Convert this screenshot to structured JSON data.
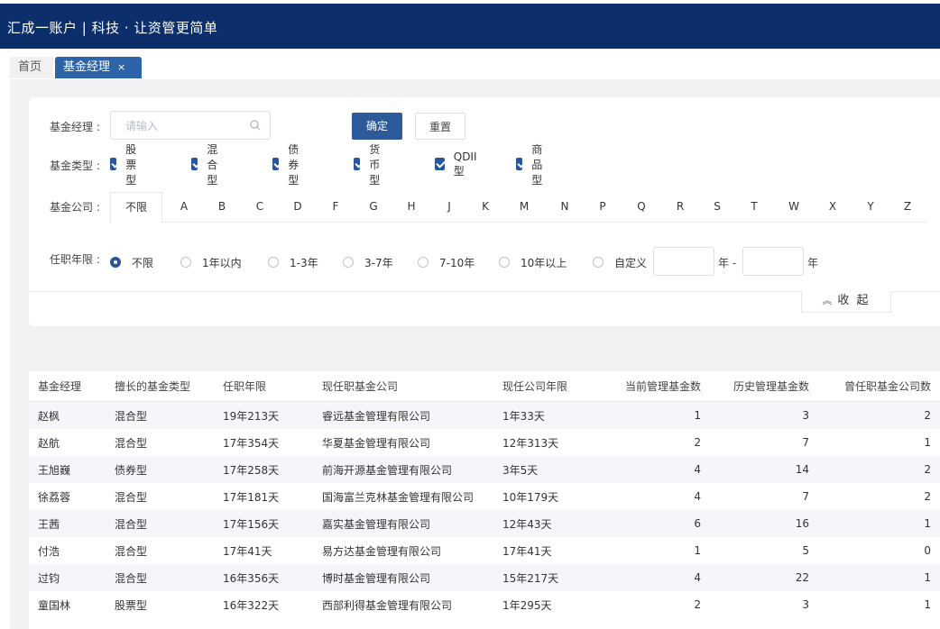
{
  "header": {
    "brand": "汇成一账户 | 科技 · 让资管更简单"
  },
  "tabs": {
    "home": "首页",
    "active": "基金经理",
    "close": "×"
  },
  "filters": {
    "manager_label": "基金经理 :",
    "manager_placeholder": "请输入",
    "confirm_label": "确定",
    "reset_label": "重置",
    "type_label": "基金类型 :",
    "types": [
      "股票型",
      "混合型",
      "债券型",
      "货币型",
      "QDII型",
      "商品型"
    ],
    "company_label": "基金公司 :",
    "letters": [
      "不限",
      "A",
      "B",
      "C",
      "D",
      "F",
      "G",
      "H",
      "J",
      "K",
      "M",
      "N",
      "P",
      "Q",
      "R",
      "S",
      "T",
      "W",
      "X",
      "Y",
      "Z"
    ],
    "tenure_label": "任职年限 :",
    "tenure_options": [
      "不限",
      "1年以内",
      "1-3年",
      "3-7年",
      "7-10年",
      "10年以上",
      "自定义"
    ],
    "tenure_selected": "不限",
    "range_mid": "年 -",
    "range_end": "年",
    "collapse_label": "收 起"
  },
  "table": {
    "columns": [
      "基金经理",
      "擅长的基金类型",
      "任职年限",
      "现任职基金公司",
      "现任公司年限",
      "当前管理基金数",
      "历史管理基金数",
      "曾任职基金公司数"
    ],
    "rows": [
      [
        "赵枫",
        "混合型",
        "19年213天",
        "睿远基金管理有限公司",
        "1年33天",
        "1",
        "3",
        "2"
      ],
      [
        "赵航",
        "混合型",
        "17年354天",
        "华夏基金管理有限公司",
        "12年313天",
        "2",
        "7",
        "1"
      ],
      [
        "王旭巍",
        "债券型",
        "17年258天",
        "前海开源基金管理有限公司",
        "3年5天",
        "4",
        "14",
        "2"
      ],
      [
        "徐荔蓉",
        "混合型",
        "17年181天",
        "国海富兰克林基金管理有限公司",
        "10年179天",
        "4",
        "7",
        "2"
      ],
      [
        "王茜",
        "混合型",
        "17年156天",
        "嘉实基金管理有限公司",
        "12年43天",
        "6",
        "16",
        "1"
      ],
      [
        "付浩",
        "混合型",
        "17年41天",
        "易方达基金管理有限公司",
        "17年41天",
        "1",
        "5",
        "0"
      ],
      [
        "过钧",
        "混合型",
        "16年356天",
        "博时基金管理有限公司",
        "15年217天",
        "4",
        "22",
        "1"
      ],
      [
        "童国林",
        "股票型",
        "16年322天",
        "西部利得基金管理有限公司",
        "1年295天",
        "2",
        "3",
        "1"
      ]
    ]
  }
}
